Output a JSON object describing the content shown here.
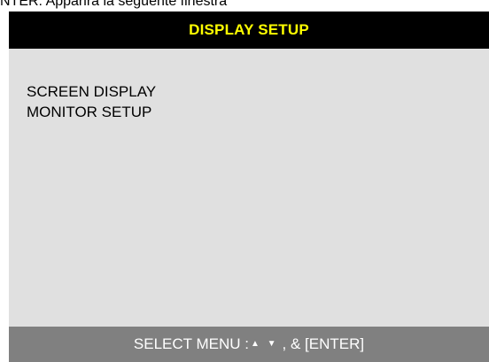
{
  "caption": "NTER: Apparirà la seguente finestra",
  "osd": {
    "title": "DISPLAY SETUP",
    "menu_items": [
      "SCREEN DISPLAY",
      "MONITOR SETUP"
    ],
    "footer": {
      "prefix": "SELECT MENU :",
      "arrows": "▲ ▼",
      "suffix": ", & [ENTER]"
    }
  },
  "colors": {
    "title_bar_bg": "#000000",
    "title_text": "#ffff00",
    "panel_bg": "#e0e0e0",
    "footer_bg": "#808080",
    "footer_text": "#ffffff"
  }
}
